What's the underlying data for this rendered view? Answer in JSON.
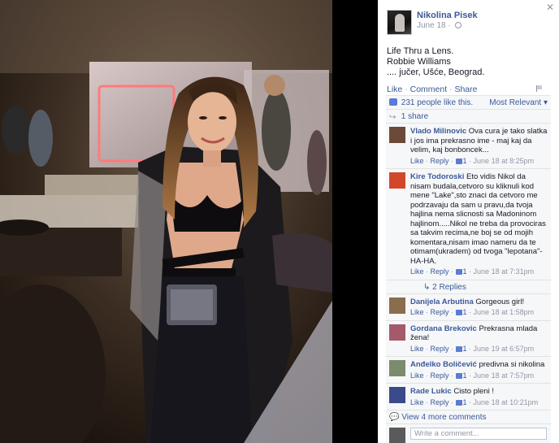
{
  "post": {
    "author": "Nikolina Pisek",
    "date": "June 18",
    "dot": "·",
    "text_lines": [
      "Life Thru a Lens.",
      "Robbie Williams",
      ".... jučer, Ušće, Beograd."
    ]
  },
  "actions": {
    "like": "Like",
    "comment": "Comment",
    "share": "Share",
    "sep": "·"
  },
  "ufi": {
    "likes": "231 people like this.",
    "sort": "Most Relevant",
    "shares": "1 share"
  },
  "comments": [
    {
      "name": "Vlado Milinovic",
      "text": "Ova cura je tako slatka i jos ima prekrasno ime - maj kaj da velim, kaj bonboncek...",
      "like": "Like",
      "reply": "Reply",
      "likes": "1",
      "time": "June 18 at 8:25pm",
      "avatar_color": "#6b4a3a"
    },
    {
      "name": "Kire Todoroski",
      "text": "Eto vidis Nikol da nisam budala,cetvoro su kliknuli kod mene \"Lake\",sto znaci da cetvoro me podrzavaju da sam u pravu,da tvoja hajlina nema slicnosti sa Madoninom hajlinom.....Nikol ne treba da provociras sa takvim recima,ne boj se od mojih komentara,nisam imao nameru da te otimam(ukradem) od tvoga \"lepotana\"-HA-HA.",
      "like": "Like",
      "reply": "Reply",
      "likes": "1",
      "time": "June 18 at 7:31pm",
      "avatar_color": "#d2472a"
    },
    {
      "name": "Danijela Arbutina",
      "text": "Gorgeous girl!",
      "like": "Like",
      "reply": "Reply",
      "likes": "1",
      "time": "June 18 at 1:58pm",
      "avatar_color": "#8a6c4e"
    },
    {
      "name": "Gordana Brekovic",
      "text": "Prekrasna mlada žena!",
      "like": "Like",
      "reply": "Reply",
      "likes": "1",
      "time": "June 19 at 6:57pm",
      "avatar_color": "#a45a6a"
    },
    {
      "name": "Anđelko Boličević",
      "text": "predivna si nikolina",
      "like": "Like",
      "reply": "Reply",
      "likes": "1",
      "time": "June 18 at 7:57pm",
      "avatar_color": "#7c8a6e"
    },
    {
      "name": "Rade Lukic",
      "text": "Cisto pleni !",
      "like": "Like",
      "reply": "Reply",
      "likes": "1",
      "time": "June 18 at 10:21pm",
      "avatar_color": "#3a4a8a"
    }
  ],
  "replies_label": "2 Replies",
  "more_comments": "View 4 more comments",
  "write": {
    "placeholder": "Write a comment...",
    "avatar_color": "#5a5a5a"
  },
  "icons": {
    "close": "close-icon",
    "globe": "globe-icon",
    "like": "like-icon",
    "share": "share-icon",
    "flag": "flag-icon"
  },
  "colors": {
    "link": "#3b5998",
    "meta": "#9197a3",
    "panel_bg": "#f6f7f9"
  }
}
